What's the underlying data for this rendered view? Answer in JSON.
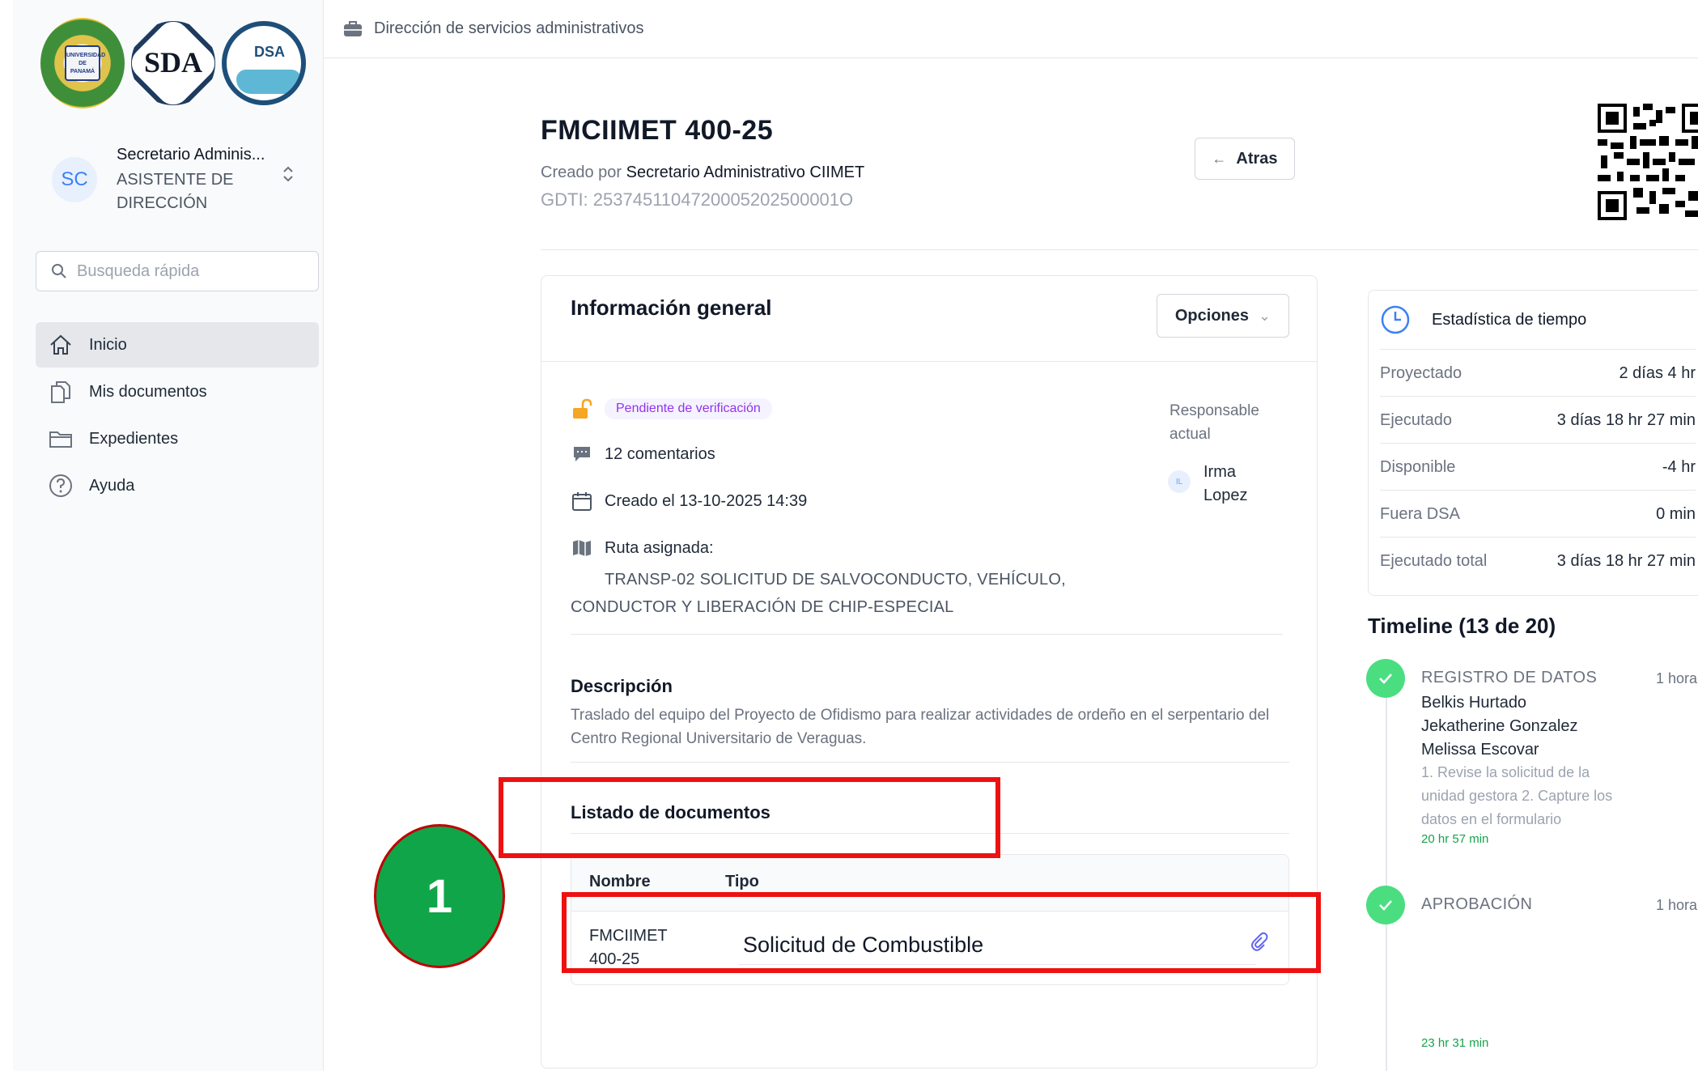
{
  "sidebar": {
    "logos": {
      "logo1_text": "UNIVERSIDAD DE PANAMÁ",
      "logo2_text": "SDA",
      "logo3_text": "DSA"
    },
    "user": {
      "initials": "SC",
      "name": "Secretario Adminis...",
      "role": "ASISTENTE DE DIRECCIÓN"
    },
    "search": {
      "placeholder": "Busqueda rápida"
    },
    "nav": [
      {
        "label": "Inicio",
        "icon": "home-icon"
      },
      {
        "label": "Mis documentos",
        "icon": "documents-icon"
      },
      {
        "label": "Expedientes",
        "icon": "folder-icon"
      },
      {
        "label": "Ayuda",
        "icon": "help-icon"
      }
    ]
  },
  "topbar": {
    "breadcrumb": "Dirección de servicios administrativos"
  },
  "document": {
    "title": "FMCIIMET 400-25",
    "created_prefix": "Creado por",
    "created_by": "Secretario Administrativo CIIMET",
    "gdti": "GDTI: 2537451104720005202500001O",
    "back_label": "Atras"
  },
  "general": {
    "title": "Información general",
    "options_label": "Opciones",
    "status": "Pendiente de verificación",
    "comments": "12 comentarios",
    "created": "Creado el 13-10-2025 14:39",
    "route_label": "Ruta asignada:",
    "route_text": "TRANSP-02 SOLICITUD DE SALVOCONDUCTO, VEHÍCULO, CONDUCTOR Y LIBERACIÓN DE CHIP-ESPECIAL",
    "responsible_label": "Responsable actual",
    "responsible_initials": "IL",
    "responsible_name": "Irma Lopez",
    "description_title": "Descripción",
    "description_text": "Traslado del equipo del Proyecto de Ofidismo para realizar actividades de ordeño en el serpentario del Centro Regional Universitario de Veraguas.",
    "documents_title": "Listado de documentos",
    "table": {
      "headers": [
        "Nombre",
        "Tipo"
      ],
      "rows": [
        {
          "name": "FMCIIMET 400-25",
          "type": "Solicitud de Combustible"
        }
      ]
    }
  },
  "stats": {
    "title": "Estadística de tiempo",
    "rows": [
      {
        "label": "Proyectado",
        "value": "2 días 4 hr"
      },
      {
        "label": "Ejecutado",
        "value": "3 días 18 hr 27 min"
      },
      {
        "label": "Disponible",
        "value": "-4 hr"
      },
      {
        "label": "Fuera DSA",
        "value": "0 min"
      },
      {
        "label": "Ejecutado total",
        "value": "3 días 18 hr 27 min"
      }
    ]
  },
  "timeline": {
    "title": "Timeline (13 de 20)",
    "steps": [
      {
        "name": "REGISTRO DE DATOS",
        "time": "1 hora",
        "people": [
          "Belkis Hurtado",
          "Jekatherine Gonzalez",
          "Melissa Escovar"
        ],
        "note": "1. Revise la solicitud de la unidad gestora 2. Capture los datos en el formulario",
        "duration": "20 hr 57 min"
      },
      {
        "name": "APROBACIÓN",
        "time": "1 hora",
        "duration": "23 hr 31 min"
      }
    ]
  },
  "annotation": {
    "number": "1"
  },
  "colors": {
    "accent_green": "#4ade80",
    "badge_purple": "#9333ea",
    "annotation_red": "#ee1111",
    "annotation_circle": "#11a54a"
  }
}
